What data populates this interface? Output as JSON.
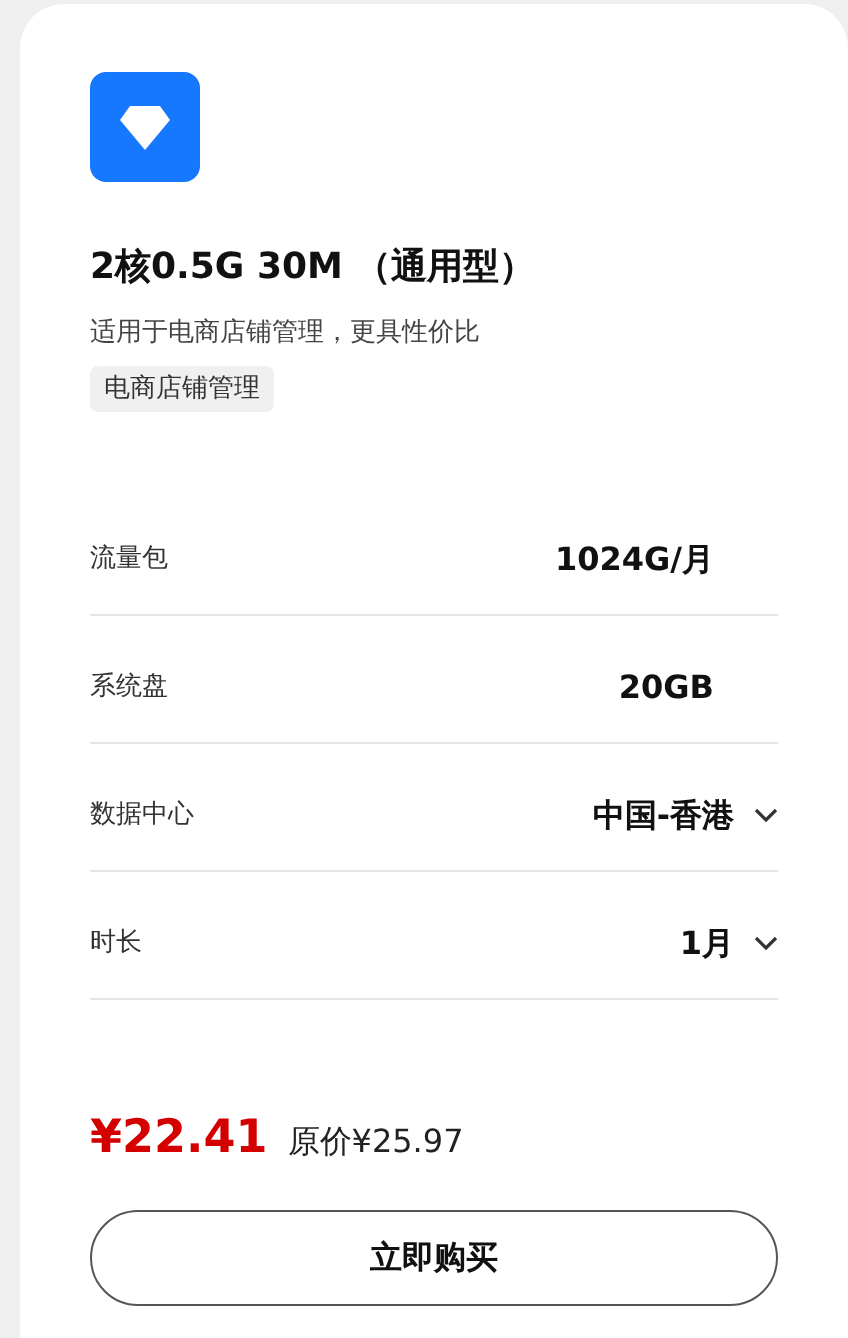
{
  "product": {
    "title": "2核0.5G 30M （通用型）",
    "subtitle": "适用于电商店铺管理，更具性价比",
    "tag": "电商店铺管理"
  },
  "specs": [
    {
      "kind": "static",
      "label": "流量包",
      "value": "1024G/月"
    },
    {
      "kind": "static",
      "label": "系统盘",
      "value": "20GB"
    },
    {
      "kind": "select",
      "label": "数据中心",
      "value": "中国-香港"
    },
    {
      "kind": "select",
      "label": "时长",
      "value": "1月"
    }
  ],
  "price": {
    "current": "¥22.41",
    "original": "原价¥25.97"
  },
  "buy_button": "立即购买"
}
